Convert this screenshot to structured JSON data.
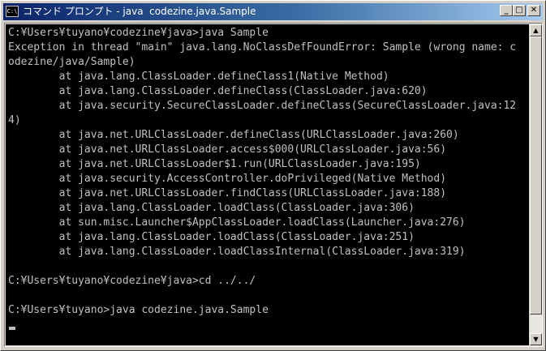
{
  "window": {
    "title": "コマンド プロンプト - java  codezine.java.Sample",
    "icon_label": "C:\\",
    "minimize_glyph": "_",
    "maximize_glyph": "□",
    "close_glyph": "✕"
  },
  "scrollbar": {
    "up_glyph": "▲",
    "down_glyph": "▼"
  },
  "console": {
    "lines": [
      "C:¥Users¥tuyano¥codezine¥java>java Sample",
      "Exception in thread \"main\" java.lang.NoClassDefFoundError: Sample (wrong name: c",
      "odezine/java/Sample)",
      "        at java.lang.ClassLoader.defineClass1(Native Method)",
      "        at java.lang.ClassLoader.defineClass(ClassLoader.java:620)",
      "        at java.security.SecureClassLoader.defineClass(SecureClassLoader.java:12",
      "4)",
      "        at java.net.URLClassLoader.defineClass(URLClassLoader.java:260)",
      "        at java.net.URLClassLoader.access$000(URLClassLoader.java:56)",
      "        at java.net.URLClassLoader$1.run(URLClassLoader.java:195)",
      "        at java.security.AccessController.doPrivileged(Native Method)",
      "        at java.net.URLClassLoader.findClass(URLClassLoader.java:188)",
      "        at java.lang.ClassLoader.loadClass(ClassLoader.java:306)",
      "        at sun.misc.Launcher$AppClassLoader.loadClass(Launcher.java:276)",
      "        at java.lang.ClassLoader.loadClass(ClassLoader.java:251)",
      "        at java.lang.ClassLoader.loadClassInternal(ClassLoader.java:319)",
      "",
      "C:¥Users¥tuyano¥codezine¥java>cd ../../",
      "",
      "C:¥Users¥tuyano>java codezine.java.Sample"
    ]
  }
}
